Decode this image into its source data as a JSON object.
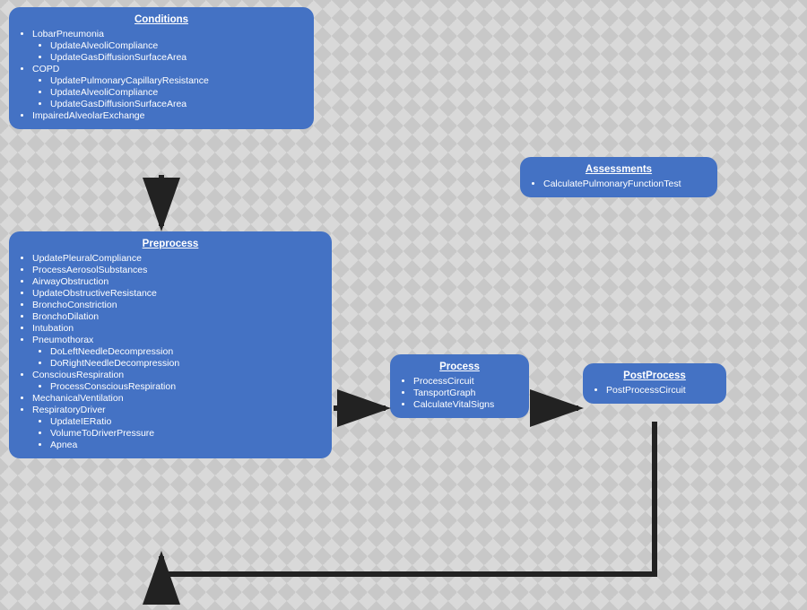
{
  "conditions": {
    "title": "Conditions",
    "items": [
      {
        "label": "LobarPneumonia",
        "children": [
          "UpdateAlveoliCompliance",
          "UpdateGasDiffusionSurfaceArea"
        ]
      },
      {
        "label": "COPD",
        "children": [
          "UpdatePulmonaryCapillaryResistance",
          "UpdateAlveoliCompliance",
          "UpdateGasDiffusionSurfaceArea"
        ]
      },
      {
        "label": "ImpairedAlveolarExchange",
        "children": []
      }
    ]
  },
  "assessments": {
    "title": "Assessments",
    "items": [
      {
        "label": "CalculatePulmonaryFunctionTest",
        "children": []
      }
    ]
  },
  "preprocess": {
    "title": "Preprocess",
    "items": [
      {
        "label": "UpdatePleuralCompliance",
        "children": []
      },
      {
        "label": "ProcessAerosolSubstances",
        "children": []
      },
      {
        "label": "AirwayObstruction",
        "children": []
      },
      {
        "label": "UpdateObstructiveResistance",
        "children": []
      },
      {
        "label": "BronchoConstriction",
        "children": []
      },
      {
        "label": "BronchoDilation",
        "children": []
      },
      {
        "label": "Intubation",
        "children": []
      },
      {
        "label": "Pneumothorax",
        "children": [
          "DoLeftNeedleDecompression",
          "DoRightNeedleDecompression"
        ]
      },
      {
        "label": "ConsciousRespiration",
        "children": [
          "ProcessConsciousRespiration"
        ]
      },
      {
        "label": "MechanicalVentilation",
        "children": []
      },
      {
        "label": "RespiratoryDriver",
        "children": [
          "UpdateIERatio",
          "VolumeToDriverPressure",
          "Apnea"
        ]
      }
    ]
  },
  "process": {
    "title": "Process",
    "items": [
      {
        "label": "ProcessCircuit",
        "children": []
      },
      {
        "label": "TansportGraph",
        "children": []
      },
      {
        "label": "CalculateVitalSigns",
        "children": []
      }
    ]
  },
  "postprocess": {
    "title": "PostProcess",
    "items": [
      {
        "label": "PostProcessCircuit",
        "children": []
      }
    ]
  }
}
